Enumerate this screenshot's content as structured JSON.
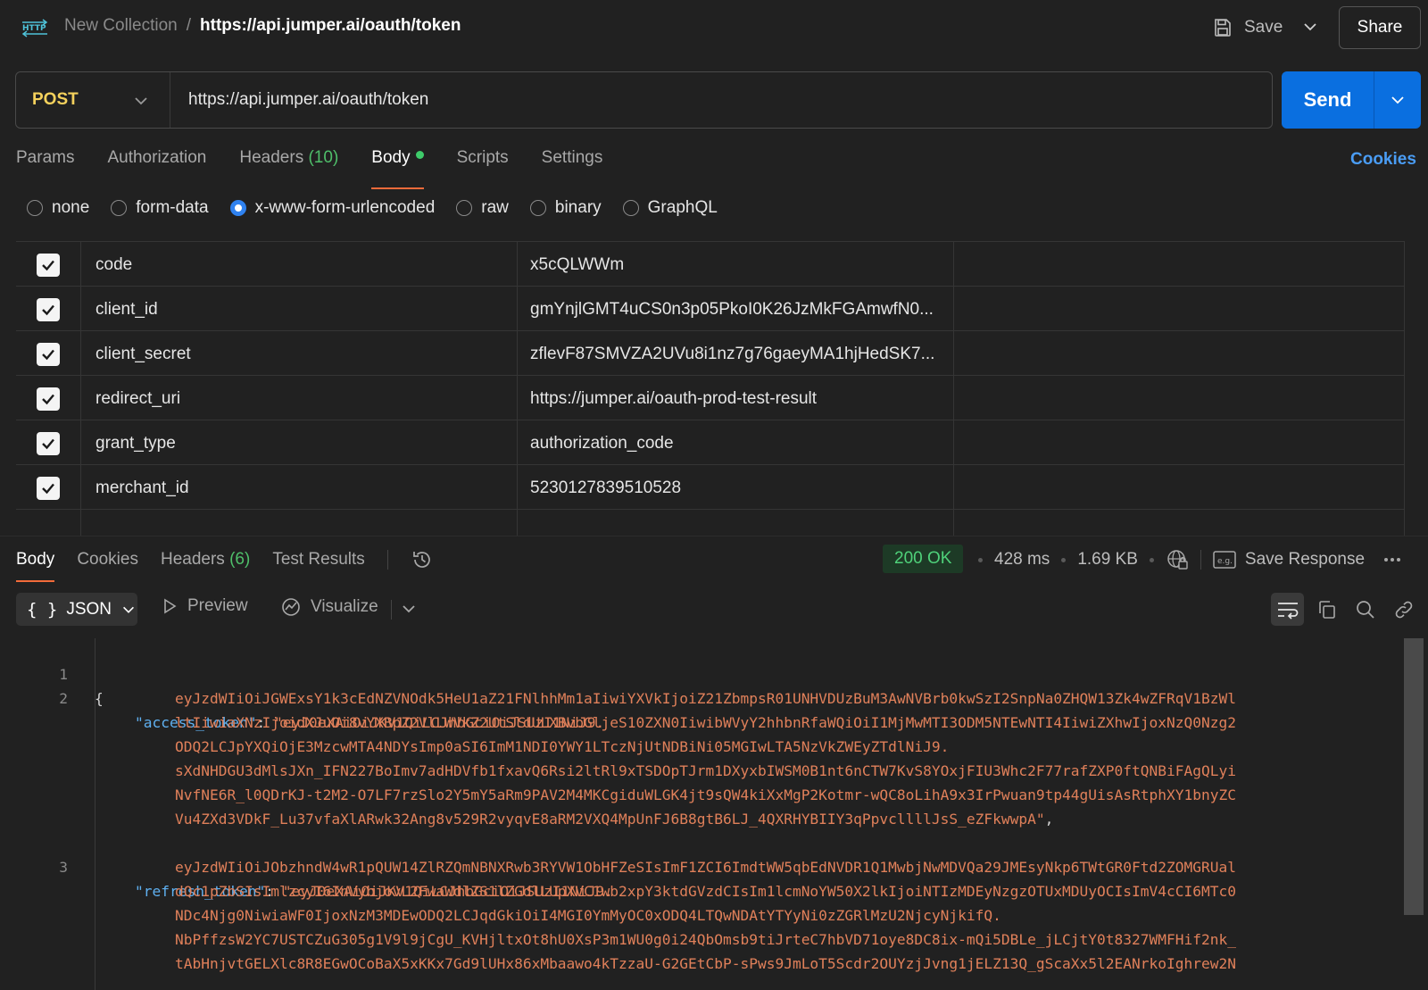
{
  "topbar": {
    "http_icon_label": "HTTP",
    "collection": "New Collection",
    "separator": "/",
    "request_name": "https://api.jumper.ai/oauth/token",
    "save_label": "Save",
    "share_label": "Share"
  },
  "request": {
    "method": "POST",
    "url": "https://api.jumper.ai/oauth/token",
    "send_label": "Send"
  },
  "request_tabs": {
    "params": "Params",
    "authorization": "Authorization",
    "headers": "Headers",
    "headers_count": "(10)",
    "body": "Body",
    "scripts": "Scripts",
    "settings": "Settings",
    "cookies": "Cookies"
  },
  "body_types": {
    "none": "none",
    "form_data": "form-data",
    "urlencoded": "x-www-form-urlencoded",
    "raw": "raw",
    "binary": "binary",
    "graphql": "GraphQL",
    "selected": "x-www-form-urlencoded"
  },
  "params": [
    {
      "key": "code",
      "value": "x5cQLWWm",
      "checked": true
    },
    {
      "key": "client_id",
      "value": "gmYnjlGMT4uCS0n3p05PkoI0K26JzMkFGAmwfN0...",
      "checked": true
    },
    {
      "key": "client_secret",
      "value": "zflevF87SMVZA2UVu8i1nz7g76gaeyMA1hjHedSK7...",
      "checked": true
    },
    {
      "key": "redirect_uri",
      "value": "https://jumper.ai/oauth-prod-test-result",
      "checked": true
    },
    {
      "key": "grant_type",
      "value": "authorization_code",
      "checked": true
    },
    {
      "key": "merchant_id",
      "value": "5230127839510528",
      "checked": true
    }
  ],
  "response_tabs": {
    "body": "Body",
    "cookies": "Cookies",
    "headers": "Headers",
    "headers_count": "(6)",
    "test_results": "Test Results"
  },
  "response_meta": {
    "status": "200 OK",
    "time": "428 ms",
    "size": "1.69 KB",
    "save_response": "Save Response"
  },
  "response_toolbar": {
    "format": "JSON",
    "preview": "Preview",
    "visualize": "Visualize"
  },
  "code": {
    "line1_num": "1",
    "line1": "{",
    "line2_num": "2",
    "access_key": "\"access_token\"",
    "colon": ": ",
    "access_0": "\"eyJ0eXAiOiJKV1QiLCJhbGciOiJSUzI1NiJ9.",
    "access_1": "eyJzdWIiOiJGWExsY1k3cEdNZVNOdk5HeU1aZ21FNlhhMm1aIiwiYXVkIjoiZ21ZbmpsR01UNHVDUzBuM3AwNVBrb0kwSzI2SnpNa0ZHQW13Zk4wZFRqV1BzWl",
    "access_2": "ltIiwiaXNzIjoidXJuOi8vYXBpZ2VlLWVkZ2UtSldULXBvbGljeS10ZXN0IiwibWVyY2hhbnRfaWQiOiI1MjMwMTI3ODM5NTEwNTI4IiwiZXhwIjoxNzQ0Nzg2",
    "access_3": "ODQ2LCJpYXQiOjE3MzcwMTA4NDYsImp0aSI6ImM1NDI0YWY1LTczNjUtNDBiNi05MGIwLTA5NzVkZWEyZTdlNiJ9.",
    "access_4": "sXdNHDGU3dMlsJXn_IFN227BoImv7adHDVfb1fxavQ6Rsi2ltRl9xTSDOpTJrm1DXyxbIWSM0B1nt6nCTW7KvS8YOxjFIU3Whc2F77rafZXP0ftQNBiFAgQLyi",
    "access_5": "NvfNE6R_l0QDrKJ-t2M2-O7LF7rzSlo2Y5mY5aRm9PAV2M4MKCgiduWLGK4jt9sQW4kiXxMgP2Kotmr-wQC8oLihA9x3IrPwuan9tp44gUisAsRtphXY1bnyZC",
    "access_6": "Vu4ZXd3VDkF_Lu37vfaXlARwk32Ang8v529R2vyqvE8aRM2VXQ4MpUnFJ6B8gtB6LJ_4QXRHYBIIY3qPpvcllllJsS_eZFkwwpA\"",
    "comma": ",",
    "line3_num": "3",
    "refresh_key": "\"refresh_token\"",
    "refresh_0": "\"eyJ0eXAiOiJKV1QiLCJhbGciOiJSUzI1NiJ9.",
    "refresh_1": "eyJzdWIiOiJObzhndW4wR1pQUW14ZlRZQmNBNXRwb3RYVW1ObHFZeSIsImF1ZCI6ImdtWW5qbEdNVDR1Q1MwbjNwMDVQa29JMEsyNkp6TWtGR0Ftd2ZOMGRUal",
    "refresh_2": "dQc1pZbSIsImlzcyI6InVybjovL2FwaWdlZS1lZGdlLUpXVC1wb2xpY3ktdGVzdCIsIm1lcmNoYW50X2lkIjoiNTIzMDEyNzgzOTUxMDUyOCIsImV4cCI6MTc0",
    "refresh_3": "NDc4Njg0NiwiaWF0IjoxNzM3MDEwODQ2LCJqdGkiOiI4MGI0YmMyOC0xODQ4LTQwNDAtYTYyNi0zZGRlMzU2NjcyNjkifQ.",
    "refresh_4": "NbPffzsW2YC7USTCZuG305g1V9l9jCgU_KVHjltxOt8hU0XsP3m1WU0g0i24QbOmsb9tiJrteC7hbVD71oye8DC8ix-mQi5DBLe_jLCjtY0t8327WMFHif2nk_",
    "refresh_5": "tAbHnjvtGELXlc8R8EGwOCoBaX5xKKx7Gd9lUHx86xMbaawo4kTzzaU-G2GEtCbP-sPws9JmLoT5Scdr2OUYzjJvng1jELZ13Q_gScaXx5l2EANrkoIghrew2N"
  },
  "colors": {
    "accent_send": "#0a6fe0",
    "method_post": "#f4d15c",
    "status_ok": "#4fd17a",
    "active_tab_underline": "#f26b3a",
    "json_key": "#5fb0f0",
    "json_string": "#e0805a"
  }
}
